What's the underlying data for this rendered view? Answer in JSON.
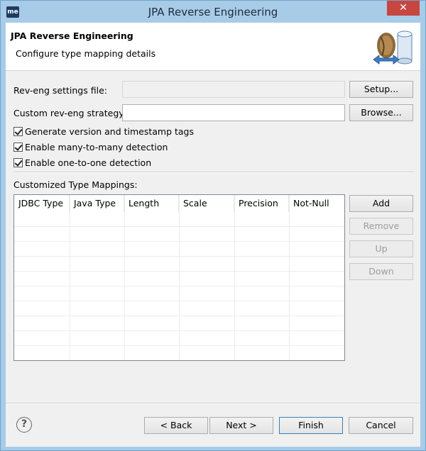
{
  "window": {
    "title": "JPA Reverse Engineering",
    "app_icon": "me",
    "close_glyph": "✕"
  },
  "header": {
    "title": "JPA Reverse Engineering",
    "subtitle": "Configure type mapping details",
    "icon": "database-wizard-icon"
  },
  "settings_file": {
    "label": "Rev-eng settings file:",
    "value": "",
    "button": "Setup..."
  },
  "strategy": {
    "label": "Custom rev-eng strategy:",
    "value": "",
    "button": "Browse..."
  },
  "checks": [
    {
      "label": "Generate version and timestamp tags",
      "checked": true
    },
    {
      "label": "Enable many-to-many detection",
      "checked": true
    },
    {
      "label": "Enable one-to-one detection",
      "checked": true
    }
  ],
  "mappings": {
    "label": "Customized Type Mappings:",
    "columns": [
      "JDBC Type",
      "Java Type",
      "Length",
      "Scale",
      "Precision",
      "Not-Null"
    ],
    "rows": [],
    "buttons": {
      "add": "Add",
      "remove": "Remove",
      "up": "Up",
      "down": "Down"
    }
  },
  "footer": {
    "help": "?",
    "back": "< Back",
    "next": "Next >",
    "finish": "Finish",
    "cancel": "Cancel"
  }
}
